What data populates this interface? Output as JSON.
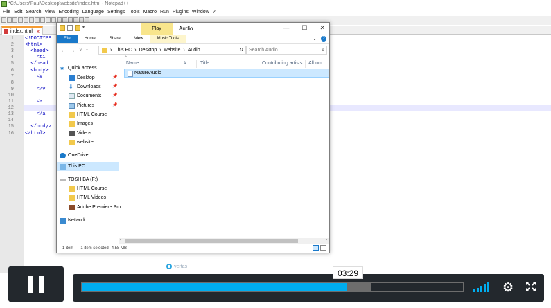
{
  "npp": {
    "title": "*C:\\Users\\Paul\\Desktop\\website\\index.html - Notepad++",
    "menu": [
      "File",
      "Edit",
      "Search",
      "View",
      "Encoding",
      "Language",
      "Settings",
      "Tools",
      "Macro",
      "Run",
      "Plugins",
      "Window",
      "?"
    ],
    "tab": "index.html",
    "line_numbers": [
      "1",
      "2",
      "3",
      "4",
      "5",
      "6",
      "7",
      "8",
      "9",
      "10",
      "11",
      "12",
      "13",
      "14",
      "15",
      "16"
    ],
    "code_lines": [
      "<!DOCTYPE",
      "<html>",
      "  <head>",
      "    <ti",
      "  </head",
      "  <body>",
      "    <v",
      "",
      "    </v",
      "",
      "    <a",
      "",
      "    </a",
      "",
      "  </body>",
      "</html>"
    ]
  },
  "explorer": {
    "play_tab": "Play",
    "title": "Audio",
    "ribbon_tabs": [
      "File",
      "Home",
      "Share",
      "View",
      "Music Tools"
    ],
    "path": [
      "This PC",
      "Desktop",
      "website",
      "Audio"
    ],
    "search_placeholder": "Search Audio",
    "nav": {
      "quick_access": "Quick access",
      "items": [
        "Desktop",
        "Downloads",
        "Documents",
        "Pictures",
        "HTML Course",
        "Images",
        "Videos",
        "website"
      ],
      "onedrive": "OneDrive",
      "this_pc": "This PC",
      "drive": "TOSHIBA (F:)",
      "drive_items": [
        "HTML Course",
        "HTML Videos",
        "Adobe Premiere Pro"
      ],
      "network": "Network"
    },
    "columns": [
      "Name",
      "#",
      "Title",
      "Contributing artists",
      "Album"
    ],
    "files": [
      "NatureAudio"
    ],
    "status": {
      "count": "1 item",
      "selected": "1 item selected",
      "size": "4.58 MB"
    }
  },
  "watermark": "vertas",
  "player": {
    "time": "03:29",
    "played_fraction": 0.697,
    "loaded_fraction": 0.76,
    "volume_level": 5
  },
  "colors": {
    "accent": "#00adef",
    "player_bg": "#23282d",
    "ribbon_file": "#1979ca"
  }
}
